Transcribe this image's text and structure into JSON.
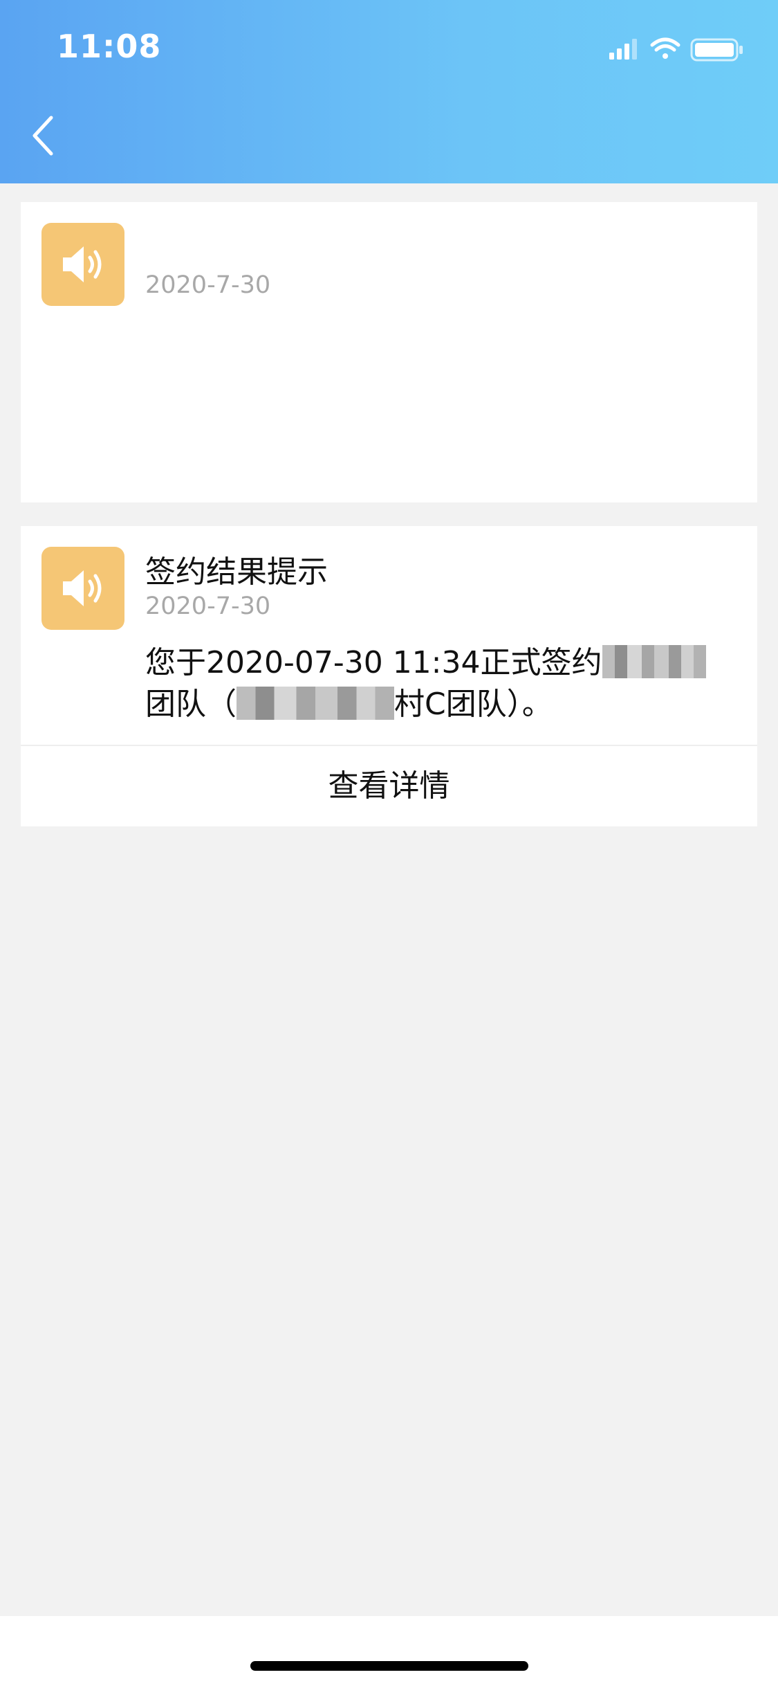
{
  "status_bar": {
    "time": "11:08",
    "icons": [
      "signal-icon",
      "wifi-icon",
      "battery-icon"
    ]
  },
  "nav": {
    "back_icon": "chevron-left-icon"
  },
  "notices": [
    {
      "icon": "speaker-icon",
      "title": "",
      "date": "2020-7-30",
      "content_parts": []
    },
    {
      "icon": "speaker-icon",
      "title": "签约结果提示",
      "date": "2020-7-30",
      "content_parts": [
        "您于2020-07-30 11:34正式签约",
        "团队（",
        "村C团队）。"
      ],
      "detail_label": "查看详情"
    }
  ],
  "colors": {
    "header_gradient_start": "#5aa4f2",
    "header_gradient_end": "#6fcdf8",
    "icon_bg": "#f5c675",
    "date_text": "#a8a8a8",
    "page_bg": "#f2f2f2"
  }
}
